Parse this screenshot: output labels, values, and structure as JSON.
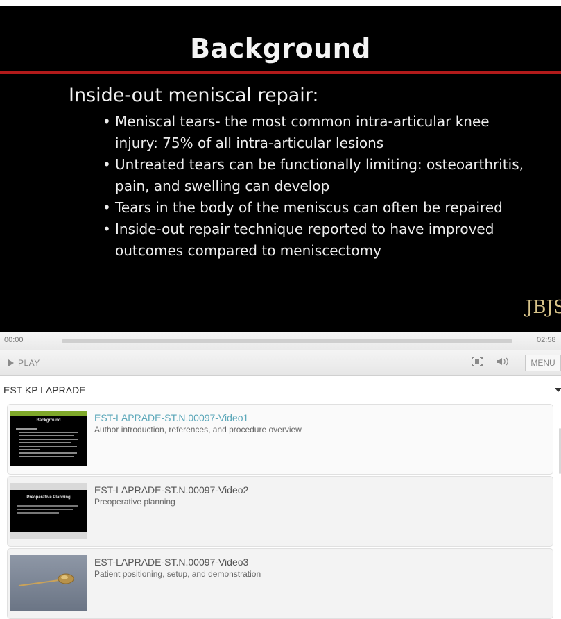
{
  "slide": {
    "title": "Background",
    "heading": "Inside-out meniscal repair:",
    "bullets": [
      "Meniscal tears- the most common intra-articular knee injury: 75% of all intra-articular lesions",
      "Untreated tears can be functionally limiting: osteoarthritis, pain, and swelling can develop",
      "Tears in the body of the meniscus can often be repaired",
      "Inside-out repair technique reported to have improved outcomes compared to meniscectomy"
    ],
    "logo": "JBJS"
  },
  "player": {
    "current_time": "00:00",
    "duration": "02:58",
    "progress_fraction": 0.0,
    "play_label": "PLAY",
    "menu_label": "MENU"
  },
  "playlist": {
    "title": "EST KP LAPRADE",
    "items": [
      {
        "title": "EST-LAPRADE-ST.N.00097-Video1",
        "description": "Author introduction, references, and procedure overview",
        "thumb_heading": "Background",
        "active": true
      },
      {
        "title": "EST-LAPRADE-ST.N.00097-Video2",
        "description": "Preoperative planning",
        "thumb_heading": "Preoperative Planning",
        "active": false
      },
      {
        "title": "EST-LAPRADE-ST.N.00097-Video3",
        "description": "Patient positioning, setup, and demonstration",
        "active": false
      }
    ]
  },
  "colors": {
    "accent_red": "#b11a1a",
    "active_title": "#5ba7b9",
    "logo_gold": "#d8c48a",
    "thumb_bar_green": "#7fa82a"
  }
}
